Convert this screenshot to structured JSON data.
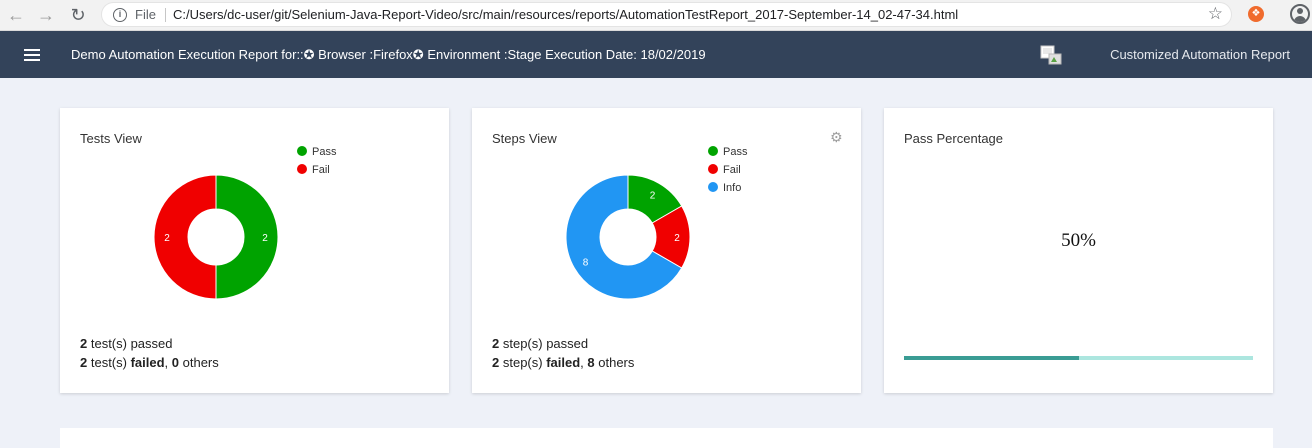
{
  "browser": {
    "file_label": "File",
    "url": "C:/Users/dc-user/git/Selenium-Java-Report-Video/src/main/resources/reports/AutomationTestReport_2017-September-14_02-47-34.html"
  },
  "header": {
    "title": "Demo Automation Execution Report for::✪ Browser :Firefox✪ Environment :Stage Execution Date: 18/02/2019",
    "right_label": "Customized Automation Report"
  },
  "colors": {
    "pass": "#00a300",
    "fail": "#f00000",
    "info": "#2196f3"
  },
  "tests_view": {
    "title": "Tests View",
    "legend": [
      "Pass",
      "Fail"
    ],
    "summary_line1_num": "2",
    "summary_line1_text": " test(s) passed",
    "summary_line2_num": "2",
    "summary_line2_mid": " test(s) ",
    "summary_line2_failed": "failed",
    "summary_line2_sep": ", ",
    "summary_line2_others_num": "0",
    "summary_line2_others": " others"
  },
  "steps_view": {
    "title": "Steps View",
    "legend": [
      "Pass",
      "Fail",
      "Info"
    ],
    "summary_line1_num": "2",
    "summary_line1_text": " step(s) passed",
    "summary_line2_num": "2",
    "summary_line2_mid": " step(s) ",
    "summary_line2_failed": "failed",
    "summary_line2_sep": ", ",
    "summary_line2_others_num": "8",
    "summary_line2_others": " others"
  },
  "pass_percentage": {
    "title": "Pass Percentage",
    "value_text": "50%",
    "fraction": 0.5
  },
  "chart_data": [
    {
      "type": "pie",
      "title": "Tests View",
      "categories": [
        "Pass",
        "Fail"
      ],
      "values": [
        2,
        2
      ],
      "colors": [
        "#00a300",
        "#f00000"
      ],
      "legend": "top-right"
    },
    {
      "type": "pie",
      "title": "Steps View",
      "categories": [
        "Pass",
        "Fail",
        "Info"
      ],
      "values": [
        2,
        2,
        8
      ],
      "colors": [
        "#00a300",
        "#f00000",
        "#2196f3"
      ],
      "legend": "top-right"
    }
  ]
}
